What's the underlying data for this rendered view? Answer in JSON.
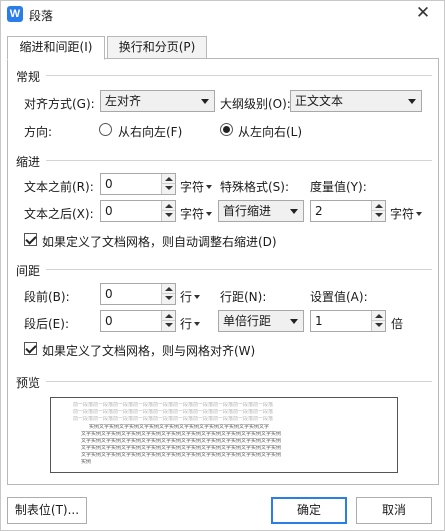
{
  "window": {
    "title": "段落",
    "app_icon_letter": "W",
    "close_glyph": "✕"
  },
  "tabs": [
    {
      "label": "缩进和间距(I)",
      "active": true
    },
    {
      "label": "换行和分页(P)",
      "active": false
    }
  ],
  "general": {
    "section_label": "常规",
    "alignment_label": "对齐方式(G):",
    "alignment_value": "左对齐",
    "outline_label": "大纲级别(O):",
    "outline_value": "正文文本",
    "direction_label": "方向:",
    "direction_rtl_label": "从右向左(F)",
    "direction_ltr_label": "从左向右(L)",
    "direction_selected": "ltr"
  },
  "indent": {
    "section_label": "缩进",
    "before_label": "文本之前(R):",
    "before_value": "0",
    "before_unit": "字符",
    "after_label": "文本之后(X):",
    "after_value": "0",
    "after_unit": "字符",
    "special_label": "特殊格式(S):",
    "special_value": "首行缩进",
    "measure_label": "度量值(Y):",
    "measure_value": "2",
    "measure_unit": "字符",
    "auto_adjust_label": "如果定义了文档网格，则自动调整右缩进(D)",
    "auto_adjust_checked": true
  },
  "spacing": {
    "section_label": "间距",
    "before_label": "段前(B):",
    "before_value": "0",
    "before_unit": "行",
    "after_label": "段后(E):",
    "after_value": "0",
    "after_unit": "行",
    "line_spacing_label": "行距(N):",
    "line_spacing_value": "单倍行距",
    "set_value_label": "设置值(A):",
    "set_value": "1",
    "set_value_unit": "倍",
    "snap_grid_label": "如果定义了文档网格，则与网格对齐(W)",
    "snap_grid_checked": true
  },
  "preview": {
    "section_label": "预览",
    "prev_line": "前一段落前一段落前一段落前一段落前一段落前一段落前一段落前一段落前一段落前一段落",
    "sample_first": "实例文字实例文字实例文字实例文字实例文字实例文字实例文字实例文字实例文字",
    "sample_line": "文字实例文字实例文字实例文字实例文字实例文字实例文字实例文字实例文字实例文字实例",
    "sample_end": "实例"
  },
  "buttons": {
    "tabs_label": "制表位(T)...",
    "ok_label": "确定",
    "cancel_label": "取消"
  }
}
